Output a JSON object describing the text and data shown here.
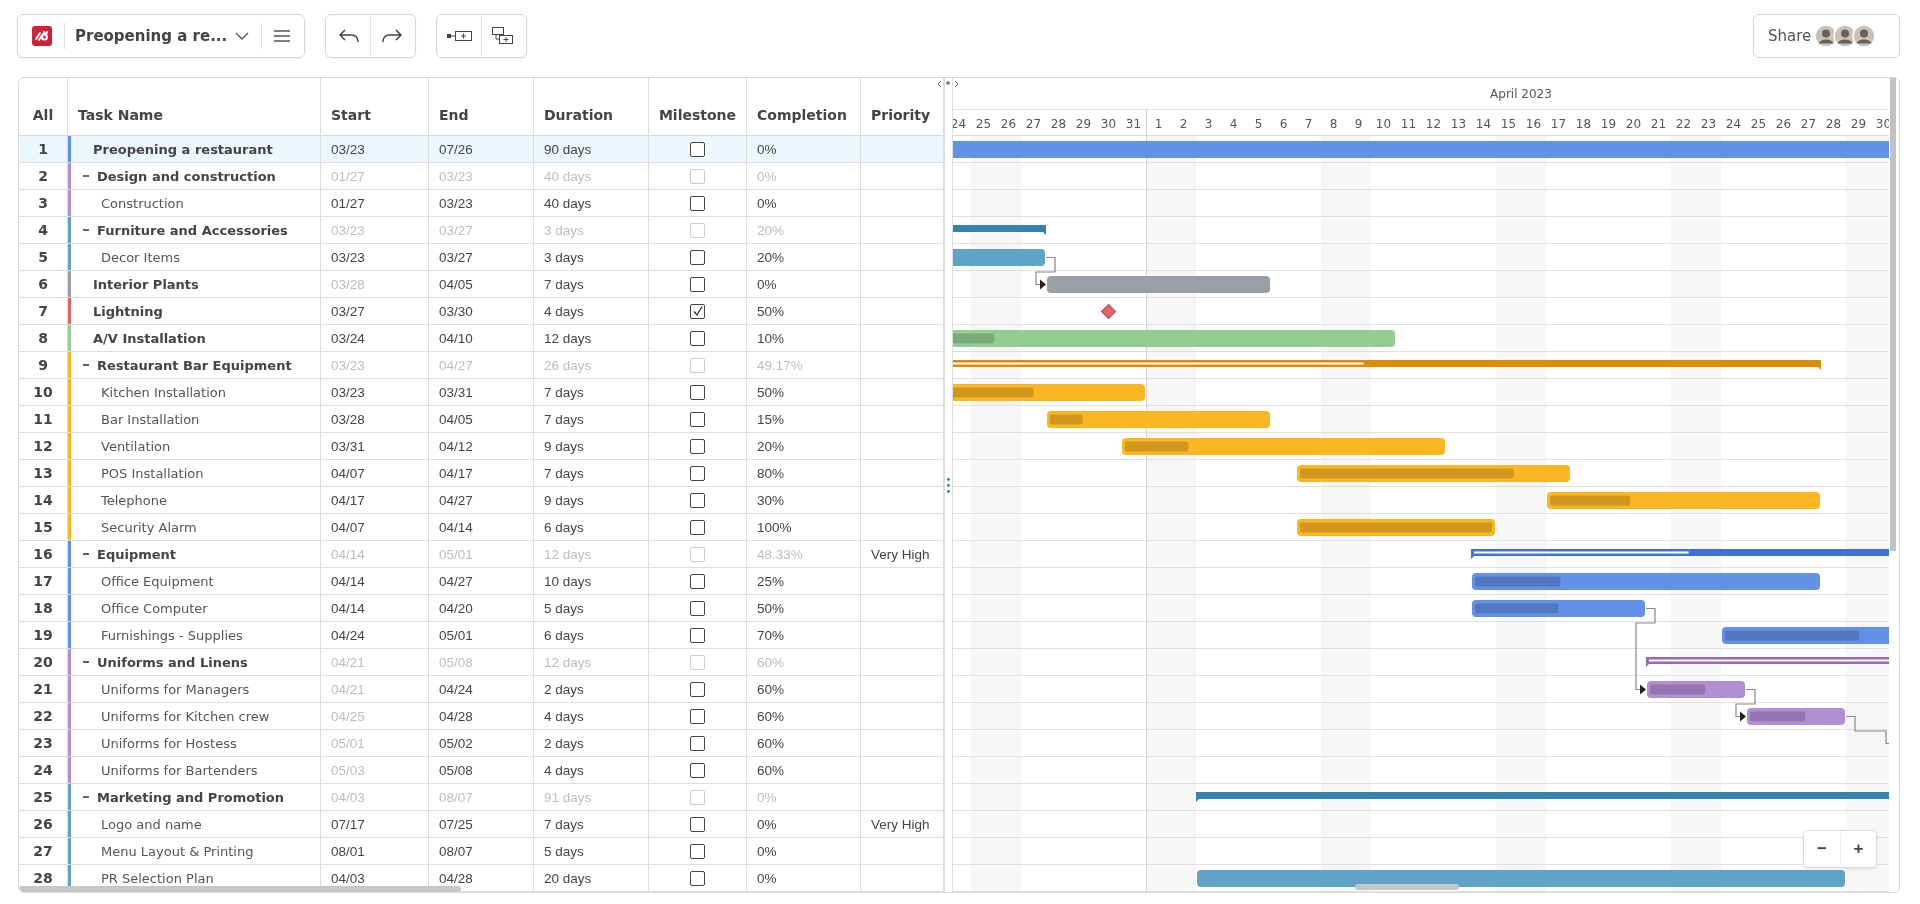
{
  "toolbar": {
    "project_title": "Preopening a re...",
    "share_label": "Share"
  },
  "columns": [
    "All",
    "Task Name",
    "Start",
    "End",
    "Duration",
    "Milestone",
    "Completion",
    "Priority"
  ],
  "timeline": {
    "month": "April 2023",
    "days": [
      {
        "label": "24",
        "weekend": false
      },
      {
        "label": "25",
        "weekend": true
      },
      {
        "label": "26",
        "weekend": true
      },
      {
        "label": "27",
        "weekend": false
      },
      {
        "label": "28",
        "weekend": false
      },
      {
        "label": "29",
        "weekend": false
      },
      {
        "label": "30",
        "weekend": false
      },
      {
        "label": "31",
        "weekend": false
      },
      {
        "label": "1",
        "weekend": true
      },
      {
        "label": "2",
        "weekend": true
      },
      {
        "label": "3",
        "weekend": false
      },
      {
        "label": "4",
        "weekend": false
      },
      {
        "label": "5",
        "weekend": false
      },
      {
        "label": "6",
        "weekend": false
      },
      {
        "label": "7",
        "weekend": false
      },
      {
        "label": "8",
        "weekend": true
      },
      {
        "label": "9",
        "weekend": true
      },
      {
        "label": "10",
        "weekend": false
      },
      {
        "label": "11",
        "weekend": false
      },
      {
        "label": "12",
        "weekend": false
      },
      {
        "label": "13",
        "weekend": false
      },
      {
        "label": "14",
        "weekend": false
      },
      {
        "label": "15",
        "weekend": true
      },
      {
        "label": "16",
        "weekend": true
      },
      {
        "label": "17",
        "weekend": false
      },
      {
        "label": "18",
        "weekend": false
      },
      {
        "label": "19",
        "weekend": false
      },
      {
        "label": "20",
        "weekend": false
      },
      {
        "label": "21",
        "weekend": false
      },
      {
        "label": "22",
        "weekend": true
      },
      {
        "label": "23",
        "weekend": true
      },
      {
        "label": "24",
        "weekend": false
      },
      {
        "label": "25",
        "weekend": false
      },
      {
        "label": "26",
        "weekend": false
      },
      {
        "label": "27",
        "weekend": false
      },
      {
        "label": "28",
        "weekend": false
      },
      {
        "label": "29",
        "weekend": true
      },
      {
        "label": "30",
        "weekend": true
      }
    ]
  },
  "tasks": [
    {
      "id": "1",
      "name": "Preopening a restaurant",
      "start": "03/23",
      "end": "07/26",
      "duration": "90 days",
      "milestone": false,
      "completion": "0%",
      "color": "#6391e8",
      "selected": true,
      "start_disabled": false
    },
    {
      "id": "2",
      "expanded": true,
      "name": "Design and construction",
      "start": "01/27",
      "end": "03/23",
      "duration": "40 days",
      "milestone": false,
      "completion": "0%",
      "color": "#b18fd3",
      "selected": false,
      "children": [
        {
          "id": "3",
          "name": "Construction",
          "start": "01/27",
          "end": "03/23",
          "duration": "40 days",
          "milestone": false,
          "completion": "0%",
          "color": "#b18fd3",
          "selected": false,
          "start_disabled": false
        }
      ]
    },
    {
      "id": "4",
      "expanded": true,
      "name": "Furniture and Accessories",
      "start": "03/23",
      "end": "03/27",
      "duration": "3 days",
      "milestone": false,
      "completion": "20%",
      "color": "#5fa4c7",
      "selected": false,
      "children": [
        {
          "id": "5",
          "name": "Decor Items",
          "start": "03/23",
          "end": "03/27",
          "duration": "3 days",
          "milestone": false,
          "completion": "20%",
          "color": "#5fa4c7",
          "selected": false,
          "start_disabled": false
        }
      ]
    },
    {
      "id": "6",
      "name": "Interior Plants",
      "start": "03/28",
      "end": "04/05",
      "duration": "7 days",
      "milestone": false,
      "completion": "0%",
      "color": "#999fa6",
      "selected": false,
      "start_disabled": true
    },
    {
      "id": "7",
      "name": "Lightning",
      "start": "03/27",
      "end": "03/30",
      "duration": "4 days",
      "milestone": true,
      "completion": "50%",
      "color": "#e06666",
      "selected": false,
      "start_disabled": false
    },
    {
      "id": "8",
      "name": "A/V Installation",
      "start": "03/24",
      "end": "04/10",
      "duration": "12 days",
      "milestone": false,
      "completion": "10%",
      "level": 0.1,
      "color": "#93cd92",
      "selected": false,
      "start_disabled": false
    },
    {
      "id": "9",
      "expanded": true,
      "name": "Restaurant Bar Equipment",
      "start": "03/23",
      "end": "04/27",
      "duration": "26 days",
      "milestone": false,
      "completion": "49.17%",
      "level": 0.4917,
      "color": "#fbb624",
      "selected": false,
      "children": [
        {
          "id": "10",
          "name": "Kitchen Installation",
          "start": "03/23",
          "end": "03/31",
          "duration": "7 days",
          "milestone": false,
          "completion": "50%",
          "level": 0.5,
          "color": "#fbb624",
          "selected": false,
          "start_disabled": false
        },
        {
          "id": "11",
          "name": "Bar Installation",
          "start": "03/28",
          "end": "04/05",
          "duration": "7 days",
          "milestone": false,
          "completion": "15%",
          "level": 0.15,
          "color": "#fbb624",
          "selected": false,
          "start_disabled": false
        },
        {
          "id": "12",
          "name": "Ventilation",
          "start": "03/31",
          "end": "04/12",
          "duration": "9 days",
          "milestone": false,
          "completion": "20%",
          "level": 0.2,
          "color": "#fbb624",
          "selected": false,
          "start_disabled": false
        },
        {
          "id": "13",
          "name": "POS Installation",
          "start": "04/07",
          "end": "04/17",
          "duration": "7 days",
          "milestone": false,
          "completion": "80%",
          "level": 0.8,
          "color": "#fbb624",
          "selected": false,
          "start_disabled": false
        },
        {
          "id": "14",
          "name": "Telephone",
          "start": "04/17",
          "end": "04/27",
          "duration": "9 days",
          "milestone": false,
          "completion": "30%",
          "level": 0.3,
          "color": "#fbb624",
          "selected": false,
          "start_disabled": false
        },
        {
          "id": "15",
          "name": "Security Alarm",
          "start": "04/07",
          "end": "04/14",
          "duration": "6 days",
          "milestone": false,
          "completion": "100%",
          "level": 1,
          "color": "#fbb624",
          "selected": false,
          "start_disabled": false
        }
      ]
    },
    {
      "id": "16",
      "expanded": true,
      "name": "Equipment",
      "start": "04/14",
      "end": "05/01",
      "duration": "12 days",
      "milestone": false,
      "completion": "48.33%",
      "level": 0.4833,
      "priority": "Very High",
      "color": "#6391e8",
      "selected": false,
      "children": [
        {
          "id": "17",
          "name": "Office Equipment",
          "start": "04/14",
          "end": "04/27",
          "duration": "10 days",
          "milestone": false,
          "completion": "25%",
          "level": 0.25,
          "color": "#6391e8",
          "selected": false,
          "start_disabled": false
        },
        {
          "id": "18",
          "name": "Office Computer",
          "start": "04/14",
          "end": "04/20",
          "duration": "5 days",
          "milestone": false,
          "completion": "50%",
          "level": 0.5,
          "color": "#6391e8",
          "selected": false,
          "start_disabled": false
        },
        {
          "id": "19",
          "name": "Furnishings - Supplies",
          "start": "04/24",
          "end": "05/01",
          "duration": "6 days",
          "milestone": false,
          "completion": "70%",
          "level": 0.7,
          "color": "#6391e8",
          "selected": false,
          "start_disabled": false
        }
      ]
    },
    {
      "id": "20",
      "expanded": true,
      "name": "Uniforms and Linens",
      "start": "04/21",
      "end": "05/08",
      "duration": "12 days",
      "milestone": false,
      "completion": "60%",
      "level": 0.6,
      "color": "#b18fd3",
      "selected": false,
      "children": [
        {
          "id": "21",
          "name": "Uniforms for Managers",
          "start": "04/21",
          "end": "04/24",
          "duration": "2 days",
          "milestone": false,
          "completion": "60%",
          "level": 0.6,
          "color": "#b18fd3",
          "selected": false,
          "start_disabled": true
        },
        {
          "id": "22",
          "name": "Uniforms for Kitchen crew",
          "start": "04/25",
          "end": "04/28",
          "duration": "4 days",
          "milestone": false,
          "completion": "60%",
          "level": 0.6,
          "color": "#b18fd3",
          "selected": false,
          "start_disabled": true
        },
        {
          "id": "23",
          "name": "Uniforms for Hostess",
          "start": "05/01",
          "end": "05/02",
          "duration": "2 days",
          "milestone": false,
          "completion": "60%",
          "color": "#b18fd3",
          "selected": false,
          "start_disabled": true
        },
        {
          "id": "24",
          "name": "Uniforms for Bartenders",
          "start": "05/03",
          "end": "05/08",
          "duration": "4 days",
          "milestone": false,
          "completion": "60%",
          "color": "#b18fd3",
          "selected": false,
          "start_disabled": true
        }
      ]
    },
    {
      "id": "25",
      "expanded": true,
      "name": "Marketing and Promotion",
      "start": "04/03",
      "end": "08/07",
      "duration": "91 days",
      "milestone": false,
      "completion": "0%",
      "color": "#5fa4c7",
      "selected": false,
      "children": [
        {
          "id": "26",
          "name": "Logo and name",
          "start": "07/17",
          "end": "07/25",
          "duration": "7 days",
          "milestone": false,
          "completion": "0%",
          "priority": "Very High",
          "color": "#5fa4c7",
          "selected": false,
          "start_disabled": false
        },
        {
          "id": "27",
          "name": "Menu Layout & Printing",
          "start": "08/01",
          "end": "08/07",
          "duration": "5 days",
          "milestone": false,
          "completion": "0%",
          "color": "#5fa4c7",
          "selected": false,
          "start_disabled": false
        },
        {
          "id": "28",
          "name": "PR Selection Plan",
          "start": "04/03",
          "end": "04/28",
          "duration": "20 days",
          "milestone": false,
          "completion": "0%",
          "color": "#5fa4c7",
          "selected": false,
          "start_disabled": false
        }
      ]
    }
  ],
  "zoom_buttons": [
    "−",
    "+"
  ]
}
